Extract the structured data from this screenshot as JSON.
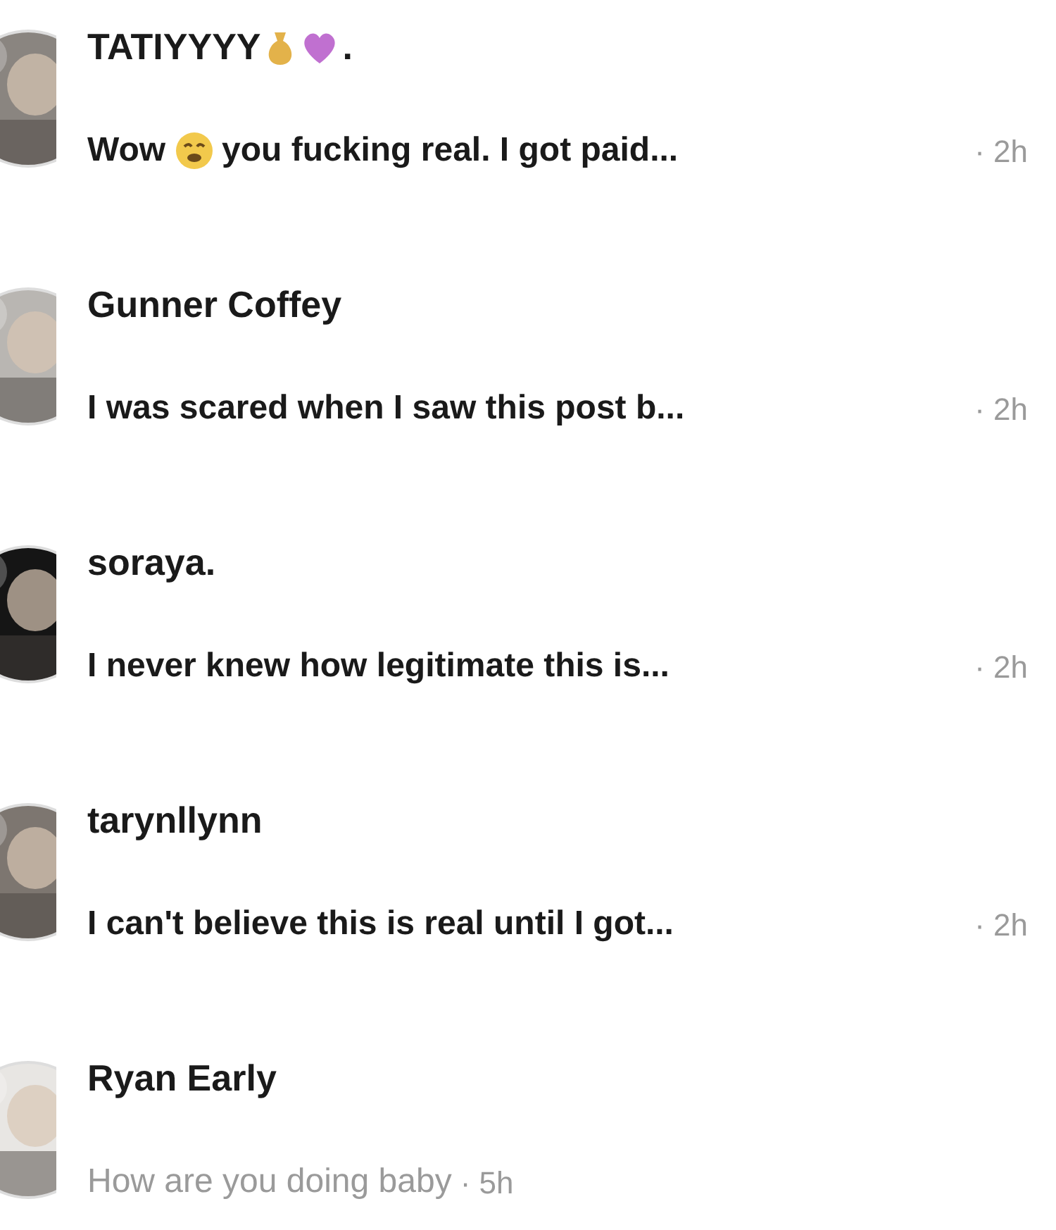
{
  "conversations": [
    {
      "kind": "decorated",
      "name": [
        "TATIYYYY",
        "."
      ],
      "message": [
        "Wow",
        "you fucking real. I got paid..."
      ],
      "time": "· 2h",
      "unread": true
    },
    {
      "kind": "plain",
      "name": [
        "Gunner Coffey"
      ],
      "message": [
        "I was scared when I saw this post b..."
      ],
      "time": "· 2h",
      "unread": true
    },
    {
      "kind": "plain",
      "name": [
        "soraya."
      ],
      "message": [
        "I never knew how legitimate this is..."
      ],
      "time": "· 2h",
      "unread": true
    },
    {
      "kind": "plain",
      "name": [
        "tarynllynn"
      ],
      "message": [
        "I can't believe this is real until I got..."
      ],
      "time": "· 2h",
      "unread": true
    },
    {
      "kind": "plain",
      "name": [
        "Ryan Early"
      ],
      "message": [
        "How are you doing baby"
      ],
      "time": "· 5h",
      "unread": false
    }
  ]
}
